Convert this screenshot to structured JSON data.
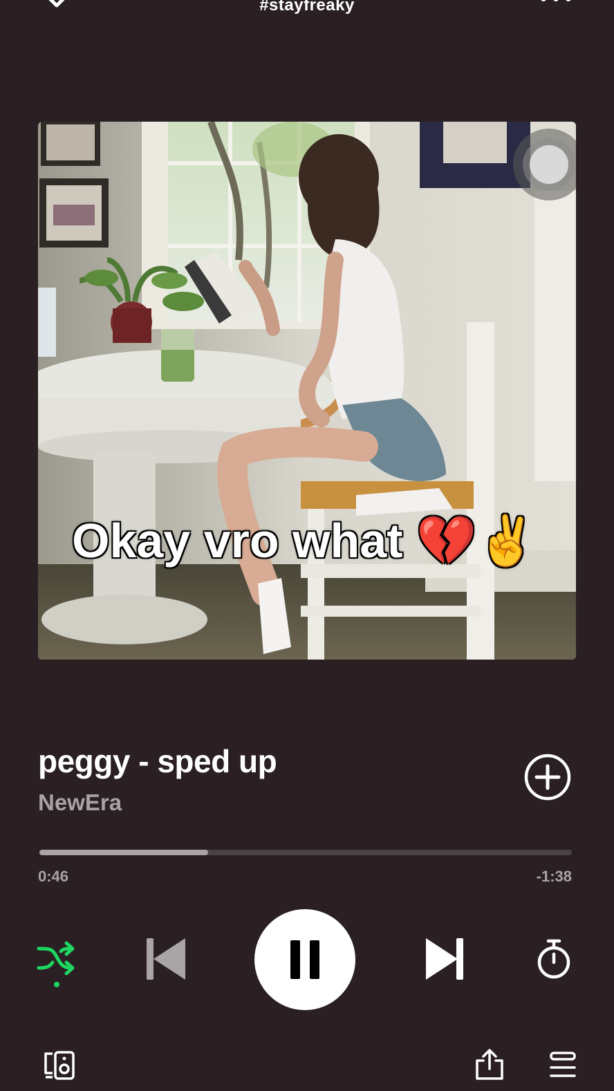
{
  "header": {
    "playlist_title": "#stayfreaky",
    "collapse_icon": "chevron-down-icon",
    "more_icon": "more-horizontal-icon"
  },
  "artwork": {
    "caption": "Okay vro what 💔✌️"
  },
  "track": {
    "title": "peggy - sped up",
    "artist": "NewEra",
    "add_icon": "plus-circle-icon"
  },
  "playback": {
    "elapsed": "0:46",
    "remaining": "-1:38",
    "progress_fraction": 0.317,
    "shuffle_active": true,
    "state": "playing"
  },
  "colors": {
    "background": "#2a2023",
    "accent_green": "#1ed760",
    "muted_text": "#a9a2a4",
    "progress_track": "#4b4245",
    "progress_fill": "#a9a4a6"
  },
  "controls": {
    "shuffle_icon": "shuffle-icon",
    "prev_icon": "skip-previous-icon",
    "pause_icon": "pause-icon",
    "next_icon": "skip-next-icon",
    "timer_icon": "sleep-timer-icon",
    "devices_icon": "connect-device-icon",
    "share_icon": "share-icon",
    "queue_icon": "queue-icon"
  }
}
